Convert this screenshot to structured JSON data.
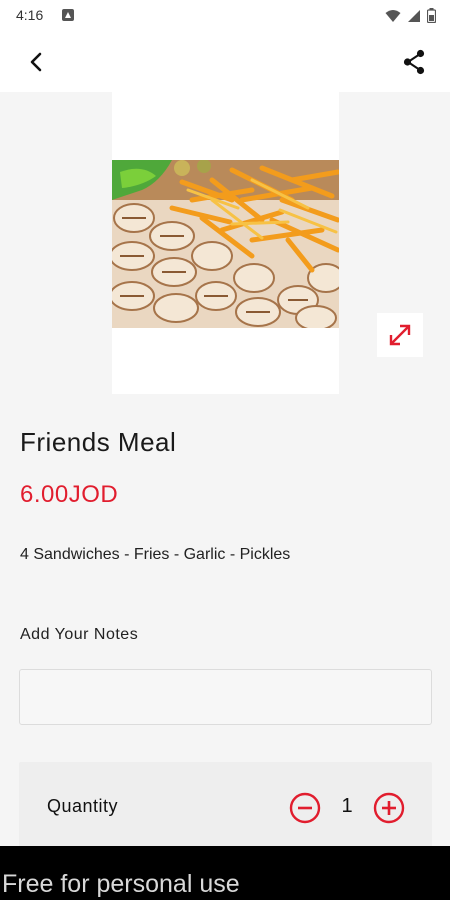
{
  "status_bar": {
    "time": "4:16",
    "icons": [
      "notification-icon",
      "wifi-icon",
      "signal-icon",
      "battery-icon"
    ]
  },
  "app_bar": {
    "back_icon": "chevron-left-icon",
    "share_icon": "share-icon"
  },
  "product": {
    "image_description_icon": "expand-icon",
    "title": "Friends Meal",
    "price": "6.00JOD",
    "description": "4 Sandwiches - Fries - Garlic - Pickles"
  },
  "notes": {
    "label": "Add Your Notes",
    "value": "",
    "placeholder": ""
  },
  "quantity": {
    "label": "Quantity",
    "value": "1",
    "minus_icon": "minus-circle-icon",
    "plus_icon": "plus-circle-icon"
  },
  "watermark": {
    "text": "Free for personal use"
  },
  "colors": {
    "accent": "#e11d2e",
    "background": "#f5f5f5",
    "watermark_bg": "#000000"
  }
}
